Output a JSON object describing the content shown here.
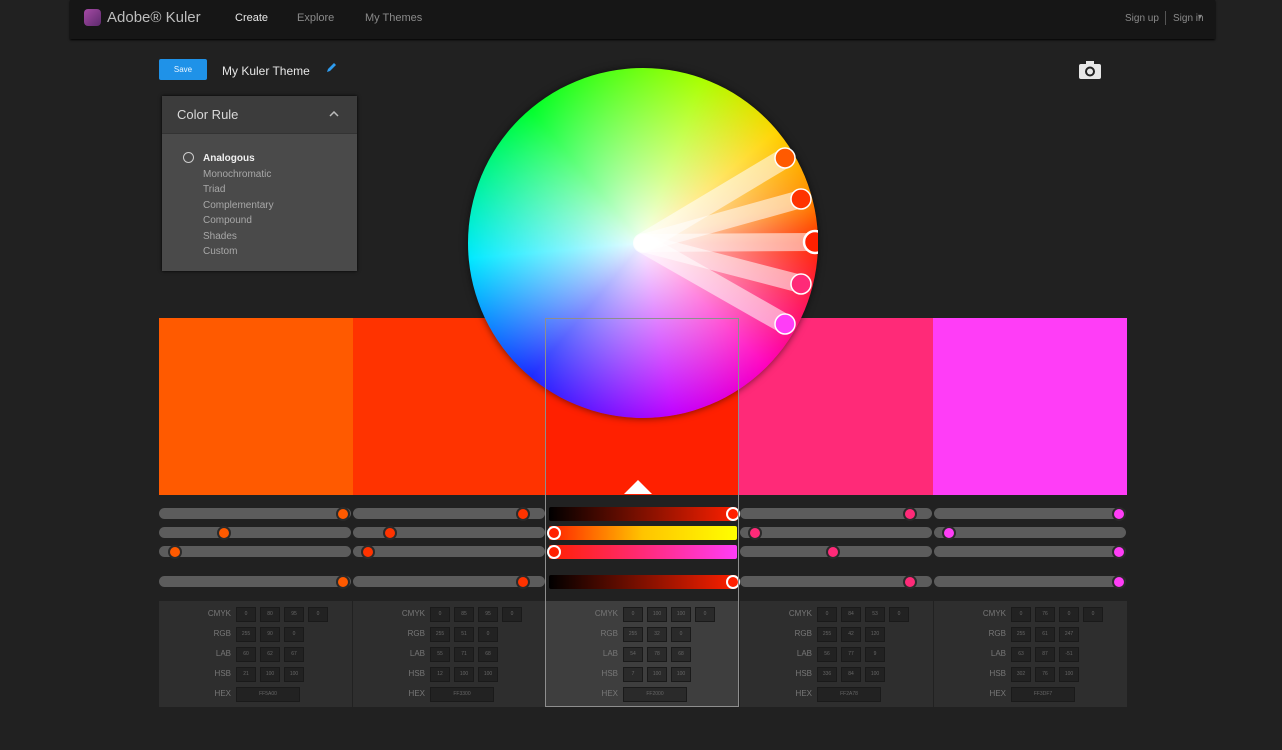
{
  "topbar": {
    "logo": "Adobe® Kuler",
    "nav": [
      "Create",
      "Explore",
      "My Themes"
    ],
    "sign_up": "Sign up",
    "sign_in": "Sign in"
  },
  "toolbar": {
    "save_label": "Save",
    "theme_name": "My Kuler Theme",
    "edit_icon": "pencil-icon",
    "capture_icon": "camera-icon"
  },
  "color_rule": {
    "title": "Color Rule",
    "options": [
      "Analogous",
      "Monochromatic",
      "Triad",
      "Complementary",
      "Compound",
      "Shades",
      "Custom"
    ],
    "selected": "Analogous"
  },
  "swatches": [
    "#ff5a00",
    "#ff3300",
    "#ff2000",
    "#ff2a78",
    "#ff3df7"
  ],
  "selected_swatch": 2,
  "mode_panels": [
    {
      "rows": [
        [
          "CMYK",
          [
            "0",
            "80",
            "95",
            "0"
          ]
        ],
        [
          "RGB",
          [
            "255",
            "90",
            "0"
          ]
        ],
        [
          "LAB",
          [
            "60",
            "62",
            "67"
          ]
        ],
        [
          "HSB",
          [
            "21",
            "100",
            "100"
          ]
        ],
        [
          "HEX",
          [
            "FF5A00"
          ]
        ]
      ]
    },
    {
      "rows": [
        [
          "CMYK",
          [
            "0",
            "85",
            "95",
            "0"
          ]
        ],
        [
          "RGB",
          [
            "255",
            "51",
            "0"
          ]
        ],
        [
          "LAB",
          [
            "55",
            "71",
            "68"
          ]
        ],
        [
          "HSB",
          [
            "12",
            "100",
            "100"
          ]
        ],
        [
          "HEX",
          [
            "FF3300"
          ]
        ]
      ]
    },
    {
      "rows": [
        [
          "CMYK",
          [
            "0",
            "100",
            "100",
            "0"
          ]
        ],
        [
          "RGB",
          [
            "255",
            "32",
            "0"
          ]
        ],
        [
          "LAB",
          [
            "54",
            "78",
            "68"
          ]
        ],
        [
          "HSB",
          [
            "7",
            "100",
            "100"
          ]
        ],
        [
          "HEX",
          [
            "FF2000"
          ]
        ]
      ]
    },
    {
      "rows": [
        [
          "CMYK",
          [
            "0",
            "84",
            "53",
            "0"
          ]
        ],
        [
          "RGB",
          [
            "255",
            "42",
            "120"
          ]
        ],
        [
          "LAB",
          [
            "56",
            "77",
            "9"
          ]
        ],
        [
          "HSB",
          [
            "336",
            "84",
            "100"
          ]
        ],
        [
          "HEX",
          [
            "FF2A78"
          ]
        ]
      ]
    },
    {
      "rows": [
        [
          "CMYK",
          [
            "0",
            "76",
            "0",
            "0"
          ]
        ],
        [
          "RGB",
          [
            "255",
            "61",
            "247"
          ]
        ],
        [
          "LAB",
          [
            "63",
            "87",
            "-51"
          ]
        ],
        [
          "HSB",
          [
            "302",
            "76",
            "100"
          ]
        ],
        [
          "HEX",
          [
            "FF3DF7"
          ]
        ]
      ]
    }
  ]
}
